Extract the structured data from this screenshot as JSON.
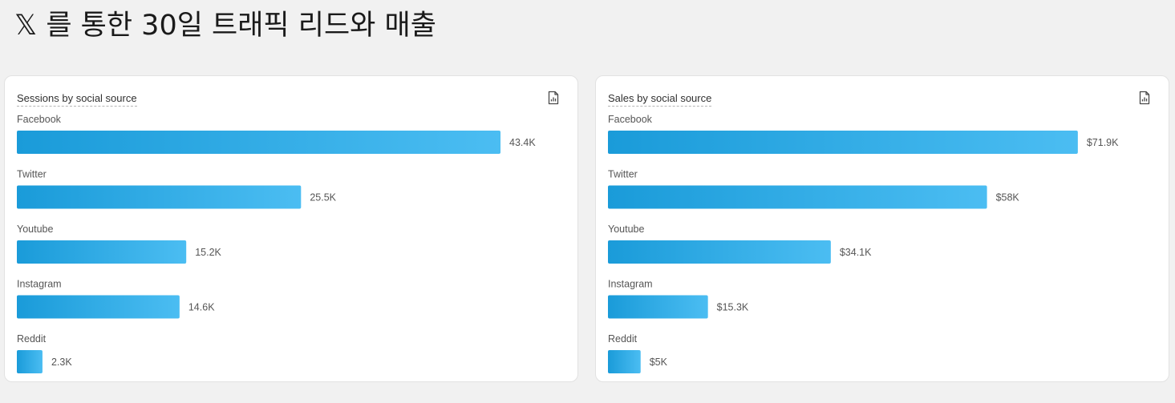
{
  "page": {
    "title": "𝕏 를 통한 30일 트래픽 리드와 매출"
  },
  "colors": {
    "bar_start": "#1a9bd9",
    "bar_end": "#4bbdf2",
    "label": "#555555",
    "value": "#555555"
  },
  "chart_data": [
    {
      "type": "bar",
      "orientation": "horizontal",
      "title": "Sessions by social source",
      "categories": [
        "Facebook",
        "Twitter",
        "Youtube",
        "Instagram",
        "Reddit"
      ],
      "values": [
        43400,
        25500,
        15200,
        14600,
        2300
      ],
      "value_labels": [
        "43.4K",
        "25.5K",
        "15.2K",
        "14.6K",
        "2.3K"
      ],
      "xlim": [
        0,
        47500
      ],
      "grid": false,
      "legend": "none"
    },
    {
      "type": "bar",
      "orientation": "horizontal",
      "title": "Sales by social source",
      "categories": [
        "Facebook",
        "Twitter",
        "Youtube",
        "Instagram",
        "Reddit"
      ],
      "values": [
        71900,
        58000,
        34100,
        15300,
        5000
      ],
      "value_labels": [
        "$71.9K",
        "$58K",
        "$34.1K",
        "$15.3K",
        "$5K"
      ],
      "xlim": [
        0,
        81000
      ],
      "grid": false,
      "legend": "none"
    }
  ]
}
